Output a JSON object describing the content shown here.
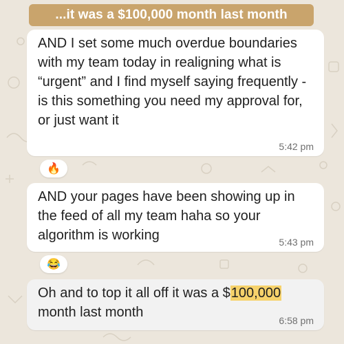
{
  "banner": {
    "text": "...it was a $100,000 month last month"
  },
  "messages": [
    {
      "text": "AND I set some much overdue boundaries with my team today in realigning what is “urgent” and I find myself saying frequently - is this something you need my approval for, or just want it",
      "time": "5:42 pm",
      "reaction": "🔥"
    },
    {
      "text": "AND your pages have been showing up in the feed of all my team haha so your algorithm is working",
      "time": "5:43 pm",
      "reaction": "😂"
    },
    {
      "text_before": "Oh and to top it all off it was a $",
      "text_highlight": "100,000",
      "text_after": " month last month",
      "time": "6:58 pm"
    }
  ],
  "colors": {
    "banner_bg": "#c9a46c",
    "bubble_bg": "#ffffff",
    "highlight": "#f6d26b",
    "chat_bg": "#ece6dc"
  }
}
